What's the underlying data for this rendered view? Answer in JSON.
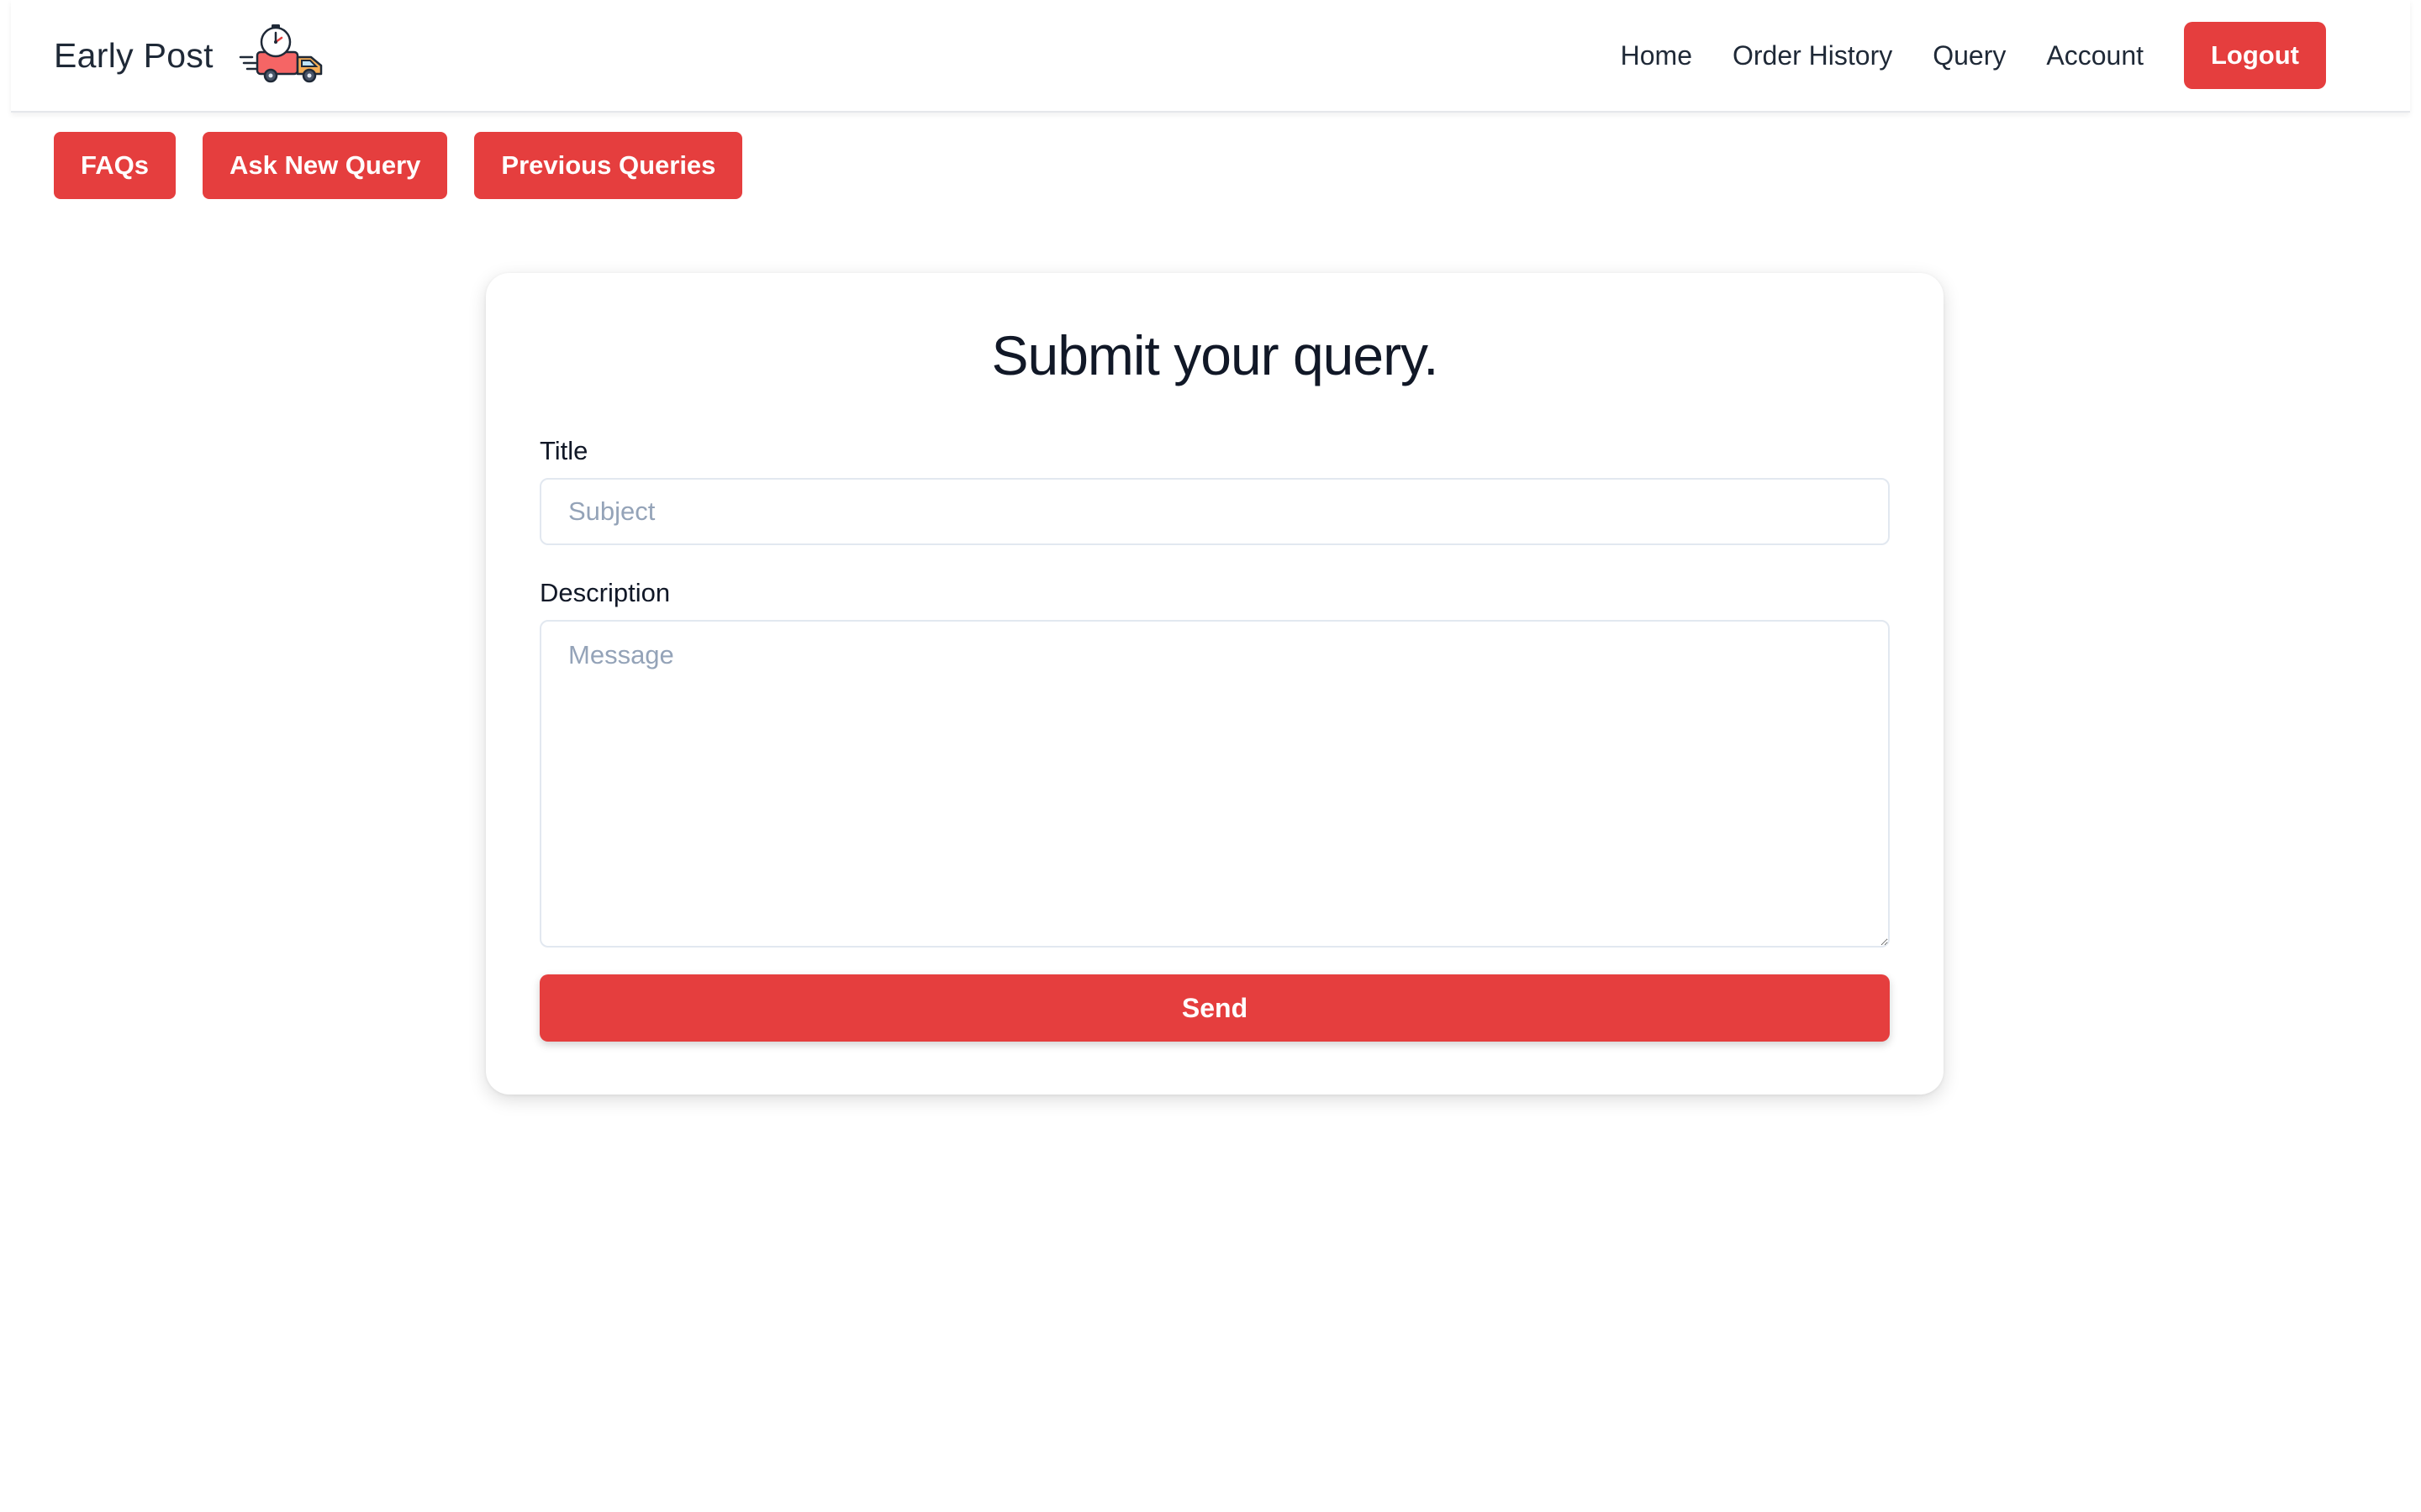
{
  "header": {
    "brand_name": "Early Post",
    "logo_icon": "delivery-truck-stopwatch-icon",
    "nav": {
      "home": "Home",
      "order_history": "Order History",
      "query": "Query",
      "account": "Account"
    },
    "logout_label": "Logout"
  },
  "subnav": {
    "faqs": "FAQs",
    "ask_new_query": "Ask New Query",
    "previous_queries": "Previous Queries"
  },
  "form": {
    "title": "Submit your query.",
    "title_label": "Title",
    "title_placeholder": "Subject",
    "title_value": "",
    "description_label": "Description",
    "description_placeholder": "Message",
    "description_value": "",
    "send_label": "Send"
  },
  "colors": {
    "accent": "#e53e3e",
    "text": "#111827",
    "placeholder": "#94a3b8",
    "border": "#e2e8f0"
  }
}
